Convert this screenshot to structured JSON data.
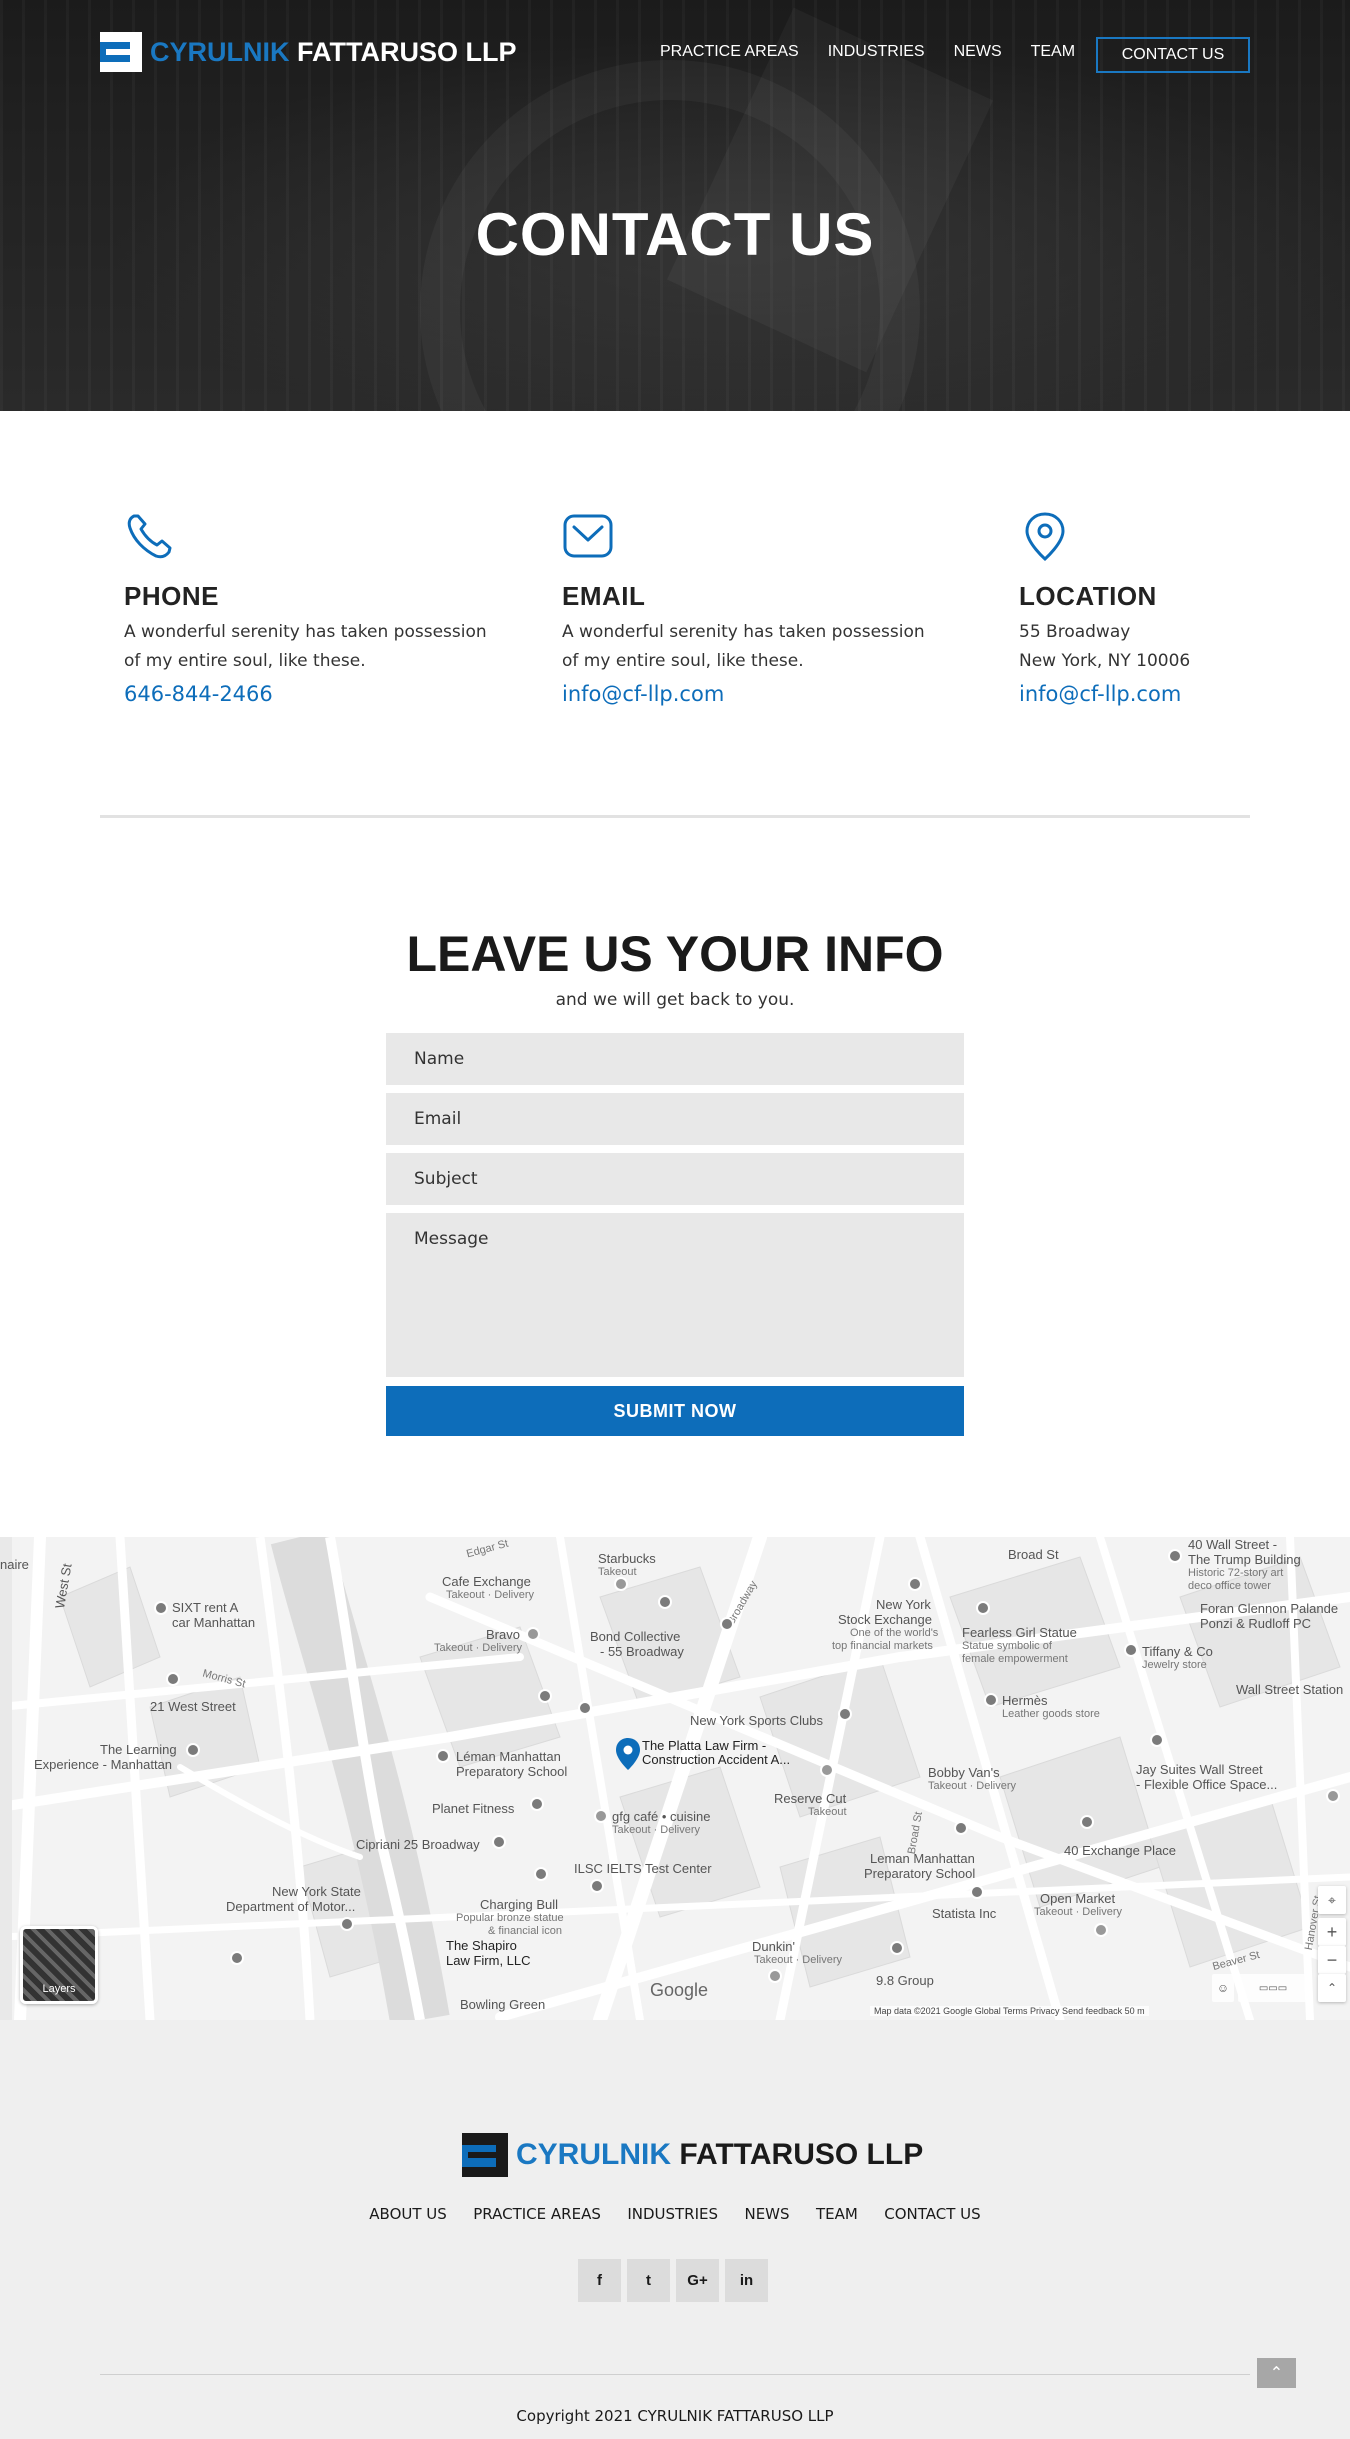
{
  "brand": {
    "name_part1": "CYRULNIK",
    "name_part2": "FATTARUSO LLP"
  },
  "nav": {
    "items": [
      "PRACTICE AREAS",
      "INDUSTRIES",
      "NEWS",
      "TEAM"
    ],
    "cta": "CONTACT US"
  },
  "hero": {
    "title": "CONTACT US"
  },
  "contact": {
    "phone": {
      "heading": "PHONE",
      "text": "A wonderful serenity has taken possession of my entire soul, like these.",
      "link": "646-844-2466",
      "icon": "phone-icon"
    },
    "email": {
      "heading": "EMAIL",
      "text": "A wonderful serenity has taken possession of my entire soul, like these.",
      "link": "info@cf-llp.com",
      "icon": "envelope-icon"
    },
    "location": {
      "heading": "LOCATION",
      "line1": "55 Broadway",
      "line2": "New York, NY 10006",
      "link": "info@cf-llp.com",
      "icon": "map-pin-icon"
    }
  },
  "form": {
    "title": "LEAVE US YOUR INFO",
    "subtitle": "and we will get back to you.",
    "name_placeholder": "Name",
    "email_placeholder": "Email",
    "subject_placeholder": "Subject",
    "message_placeholder": "Message",
    "submit": "SUBMIT NOW"
  },
  "map": {
    "labels": {
      "starbucks": "Starbucks",
      "starbucks_sub": "Takeout",
      "cafe_exchange": "Cafe Exchange",
      "cafe_exchange_sub": "Takeout · Delivery",
      "bravo": "Bravo",
      "bravo_sub": "Takeout · Delivery",
      "bond": "Bond Collective",
      "bond2": "- 55 Broadway",
      "sixt": "SIXT rent A",
      "sixt2": "car Manhattan",
      "west21": "21 West Street",
      "learning": "The Learning",
      "learning2": "Experience - Manhattan",
      "leman": "Léman Manhattan",
      "leman2": "Preparatory School",
      "planet": "Planet Fitness",
      "cipriani": "Cipriani 25 Broadway",
      "nys": "New York State",
      "nys2": "Department of Motor...",
      "charging": "Charging Bull",
      "charging2": "Popular bronze statue",
      "charging3": "& financial icon",
      "shapiro": "The Shapiro",
      "shapiro2": "Law Firm, LLC",
      "bowling": "Bowling Green",
      "platta": "The Platta Law Firm -",
      "platta2": "Construction Accident A...",
      "nysports": "New York Sports Clubs",
      "nyse": "New York",
      "nyse2": "Stock Exchange",
      "nyse3": "One of the world's",
      "nyse4": "top financial markets",
      "fearless": "Fearless Girl Statue",
      "fearless2": "Statue symbolic of",
      "fearless3": "female empowerment",
      "broadst": "Broad St",
      "wall40": "40 Wall Street -",
      "wall40b": "The Trump Building",
      "wall40c": "Historic 72-story art",
      "wall40d": "deco office tower",
      "foran": "Foran Glennon Palande",
      "foran2": "Ponzi & Rudloff PC",
      "tiffany": "Tiffany & Co",
      "tiffany2": "Jewelry store",
      "hermes": "Hermès",
      "hermes2": "Leather goods store",
      "wallst_station": "Wall Street Station",
      "bobby": "Bobby Van's",
      "bobby2": "Takeout · Delivery",
      "reserve": "Reserve Cut",
      "reserve2": "Takeout",
      "gfg": "gfg café • cuisine",
      "gfg2": "Takeout · Delivery",
      "jay": "Jay Suites Wall Street",
      "jay2": "- Flexible Office Space...",
      "exchange40": "40 Exchange Place",
      "ilsc": "ILSC IELTS Test Center",
      "leman_b": "Leman Manhattan",
      "leman_b2": "Preparatory School",
      "statista": "Statista Inc",
      "openmarket": "Open Market",
      "openmarket2": "Takeout · Delivery",
      "dunkin": "Dunkin'",
      "dunkin2": "Takeout · Delivery",
      "group98": "9.8 Group",
      "naire": "naire",
      "westst": "West St",
      "morris": "Morris St",
      "broadway": "Broadway",
      "edgar": "Edgar St",
      "beaver": "Beaver St",
      "hanover": "Hanover St",
      "broad_road": "Broad St"
    },
    "layers_label": "Layers",
    "google": "Google",
    "footer_text": "Map data ©2021 Google   Global   Terms   Privacy   Send feedback   50 m"
  },
  "footer": {
    "nav": [
      "ABOUT US",
      "PRACTICE AREAS",
      "INDUSTRIES",
      "NEWS",
      "TEAM",
      "CONTACT US"
    ],
    "social": [
      {
        "icon": "facebook-icon",
        "glyph": "f"
      },
      {
        "icon": "twitter-icon",
        "glyph": "t"
      },
      {
        "icon": "google-plus-icon",
        "glyph": "G+"
      },
      {
        "icon": "linkedin-icon",
        "glyph": "in"
      }
    ],
    "copyright": "Copyright 2021 CYRULNIK FATTARUSO LLP",
    "to_top": "⌃"
  },
  "colors": {
    "accent": "#0d6dba",
    "hero_bg": "#1e1e1e",
    "footer_bg": "#efefef",
    "field_bg": "#e8e8e8"
  }
}
